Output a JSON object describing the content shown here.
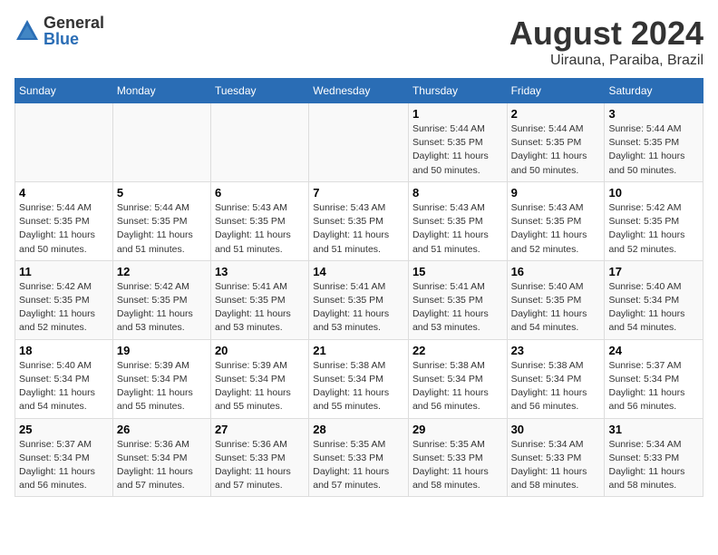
{
  "header": {
    "logo_general": "General",
    "logo_blue": "Blue",
    "title": "August 2024",
    "subtitle": "Uirauna, Paraiba, Brazil"
  },
  "days_of_week": [
    "Sunday",
    "Monday",
    "Tuesday",
    "Wednesday",
    "Thursday",
    "Friday",
    "Saturday"
  ],
  "weeks": [
    {
      "cells": [
        {
          "day": "",
          "info": ""
        },
        {
          "day": "",
          "info": ""
        },
        {
          "day": "",
          "info": ""
        },
        {
          "day": "",
          "info": ""
        },
        {
          "day": "1",
          "info": "Sunrise: 5:44 AM\nSunset: 5:35 PM\nDaylight: 11 hours\nand 50 minutes."
        },
        {
          "day": "2",
          "info": "Sunrise: 5:44 AM\nSunset: 5:35 PM\nDaylight: 11 hours\nand 50 minutes."
        },
        {
          "day": "3",
          "info": "Sunrise: 5:44 AM\nSunset: 5:35 PM\nDaylight: 11 hours\nand 50 minutes."
        }
      ]
    },
    {
      "cells": [
        {
          "day": "4",
          "info": "Sunrise: 5:44 AM\nSunset: 5:35 PM\nDaylight: 11 hours\nand 50 minutes."
        },
        {
          "day": "5",
          "info": "Sunrise: 5:44 AM\nSunset: 5:35 PM\nDaylight: 11 hours\nand 51 minutes."
        },
        {
          "day": "6",
          "info": "Sunrise: 5:43 AM\nSunset: 5:35 PM\nDaylight: 11 hours\nand 51 minutes."
        },
        {
          "day": "7",
          "info": "Sunrise: 5:43 AM\nSunset: 5:35 PM\nDaylight: 11 hours\nand 51 minutes."
        },
        {
          "day": "8",
          "info": "Sunrise: 5:43 AM\nSunset: 5:35 PM\nDaylight: 11 hours\nand 51 minutes."
        },
        {
          "day": "9",
          "info": "Sunrise: 5:43 AM\nSunset: 5:35 PM\nDaylight: 11 hours\nand 52 minutes."
        },
        {
          "day": "10",
          "info": "Sunrise: 5:42 AM\nSunset: 5:35 PM\nDaylight: 11 hours\nand 52 minutes."
        }
      ]
    },
    {
      "cells": [
        {
          "day": "11",
          "info": "Sunrise: 5:42 AM\nSunset: 5:35 PM\nDaylight: 11 hours\nand 52 minutes."
        },
        {
          "day": "12",
          "info": "Sunrise: 5:42 AM\nSunset: 5:35 PM\nDaylight: 11 hours\nand 53 minutes."
        },
        {
          "day": "13",
          "info": "Sunrise: 5:41 AM\nSunset: 5:35 PM\nDaylight: 11 hours\nand 53 minutes."
        },
        {
          "day": "14",
          "info": "Sunrise: 5:41 AM\nSunset: 5:35 PM\nDaylight: 11 hours\nand 53 minutes."
        },
        {
          "day": "15",
          "info": "Sunrise: 5:41 AM\nSunset: 5:35 PM\nDaylight: 11 hours\nand 53 minutes."
        },
        {
          "day": "16",
          "info": "Sunrise: 5:40 AM\nSunset: 5:35 PM\nDaylight: 11 hours\nand 54 minutes."
        },
        {
          "day": "17",
          "info": "Sunrise: 5:40 AM\nSunset: 5:34 PM\nDaylight: 11 hours\nand 54 minutes."
        }
      ]
    },
    {
      "cells": [
        {
          "day": "18",
          "info": "Sunrise: 5:40 AM\nSunset: 5:34 PM\nDaylight: 11 hours\nand 54 minutes."
        },
        {
          "day": "19",
          "info": "Sunrise: 5:39 AM\nSunset: 5:34 PM\nDaylight: 11 hours\nand 55 minutes."
        },
        {
          "day": "20",
          "info": "Sunrise: 5:39 AM\nSunset: 5:34 PM\nDaylight: 11 hours\nand 55 minutes."
        },
        {
          "day": "21",
          "info": "Sunrise: 5:38 AM\nSunset: 5:34 PM\nDaylight: 11 hours\nand 55 minutes."
        },
        {
          "day": "22",
          "info": "Sunrise: 5:38 AM\nSunset: 5:34 PM\nDaylight: 11 hours\nand 56 minutes."
        },
        {
          "day": "23",
          "info": "Sunrise: 5:38 AM\nSunset: 5:34 PM\nDaylight: 11 hours\nand 56 minutes."
        },
        {
          "day": "24",
          "info": "Sunrise: 5:37 AM\nSunset: 5:34 PM\nDaylight: 11 hours\nand 56 minutes."
        }
      ]
    },
    {
      "cells": [
        {
          "day": "25",
          "info": "Sunrise: 5:37 AM\nSunset: 5:34 PM\nDaylight: 11 hours\nand 56 minutes."
        },
        {
          "day": "26",
          "info": "Sunrise: 5:36 AM\nSunset: 5:34 PM\nDaylight: 11 hours\nand 57 minutes."
        },
        {
          "day": "27",
          "info": "Sunrise: 5:36 AM\nSunset: 5:33 PM\nDaylight: 11 hours\nand 57 minutes."
        },
        {
          "day": "28",
          "info": "Sunrise: 5:35 AM\nSunset: 5:33 PM\nDaylight: 11 hours\nand 57 minutes."
        },
        {
          "day": "29",
          "info": "Sunrise: 5:35 AM\nSunset: 5:33 PM\nDaylight: 11 hours\nand 58 minutes."
        },
        {
          "day": "30",
          "info": "Sunrise: 5:34 AM\nSunset: 5:33 PM\nDaylight: 11 hours\nand 58 minutes."
        },
        {
          "day": "31",
          "info": "Sunrise: 5:34 AM\nSunset: 5:33 PM\nDaylight: 11 hours\nand 58 minutes."
        }
      ]
    }
  ]
}
